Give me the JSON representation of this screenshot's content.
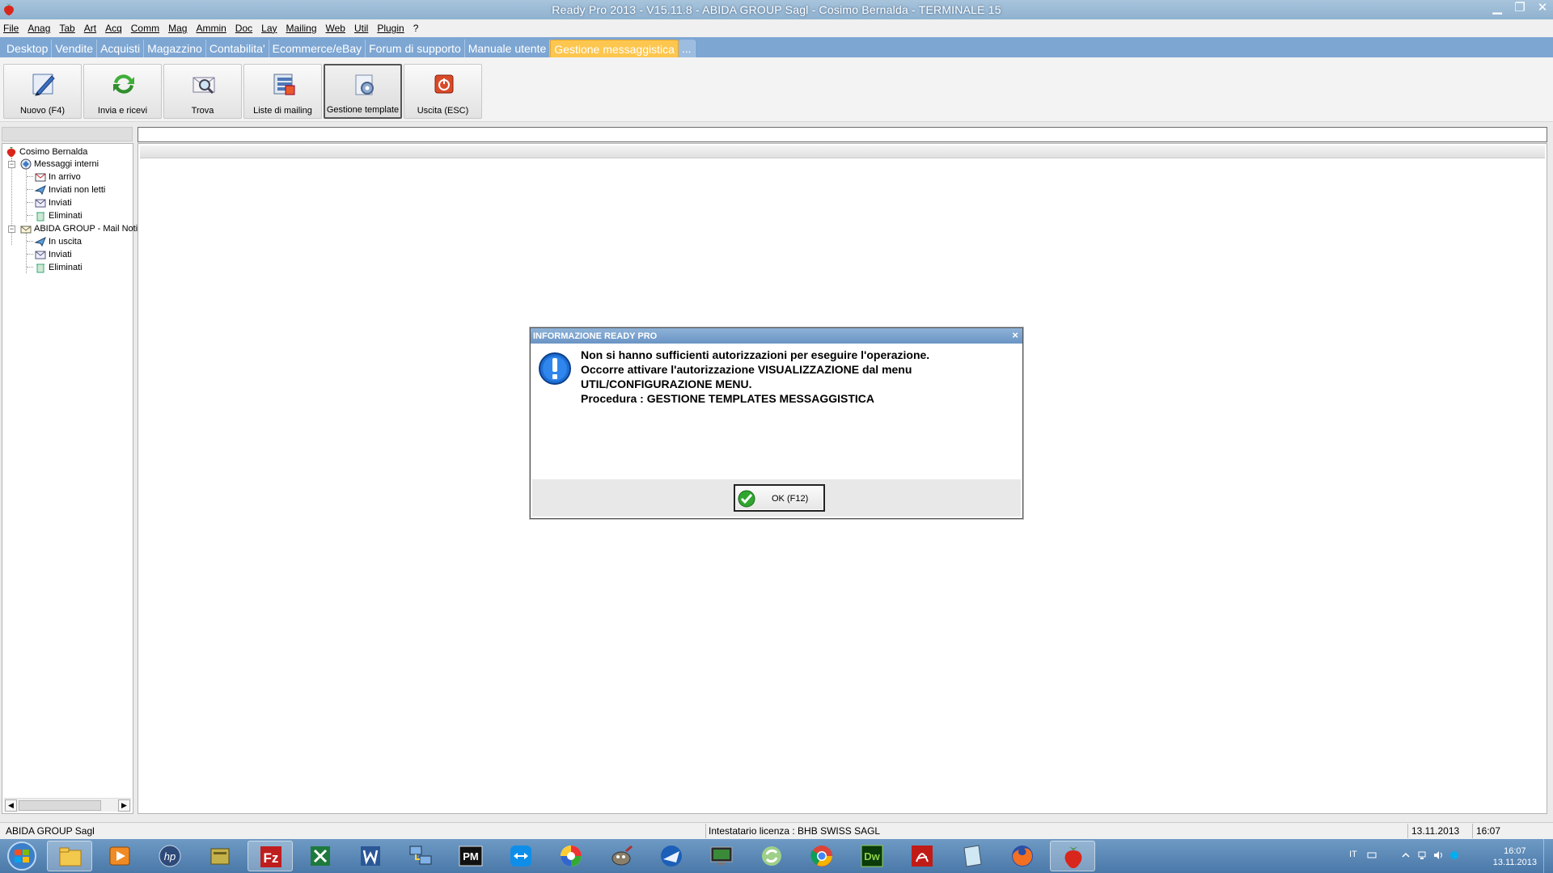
{
  "window": {
    "title": "Ready Pro 2013 - V15.11.8 - ABIDA GROUP Sagl - Cosimo Bernalda - TERMINALE 15",
    "minimize": "▁",
    "restore": "❐",
    "close": "✕"
  },
  "menu": [
    "File",
    "Anag",
    "Tab",
    "Art",
    "Acq",
    "Comm",
    "Mag",
    "Ammin",
    "Doc",
    "Lay",
    "Mailing",
    "Web",
    "Util",
    "Plugin",
    "?"
  ],
  "tabs": [
    {
      "label": "Desktop",
      "active": false
    },
    {
      "label": "Vendite",
      "active": false
    },
    {
      "label": "Acquisti",
      "active": false
    },
    {
      "label": "Magazzino",
      "active": false
    },
    {
      "label": "Contabilita'",
      "active": false
    },
    {
      "label": "Ecommerce/eBay",
      "active": false
    },
    {
      "label": "Forum di supporto",
      "active": false
    },
    {
      "label": "Manuale utente",
      "active": false
    },
    {
      "label": "Gestione messaggistica",
      "active": true
    },
    {
      "label": "...",
      "active": false
    }
  ],
  "toolbar": {
    "new": "Nuovo (F4)",
    "send_receive": "Invia e ricevi",
    "find": "Trova",
    "mailing_lists": "Liste di mailing",
    "templates": "Gestione template",
    "exit": "Uscita (ESC)"
  },
  "tree": {
    "root": "Cosimo Bernalda",
    "internal": {
      "label": "Messaggi interni",
      "items": [
        "In arrivo",
        "Inviati non letti",
        "Inviati",
        "Eliminati"
      ]
    },
    "account": {
      "label": "ABIDA GROUP - Mail Noti",
      "items": [
        "In uscita",
        "Inviati",
        "Eliminati"
      ]
    }
  },
  "dialog": {
    "title": "INFORMAZIONE READY PRO",
    "close": "×",
    "lines": [
      "Non si hanno sufficienti autorizzazioni per eseguire l'operazione.",
      "Occorre attivare l'autorizzazione VISUALIZZAZIONE dal menu",
      "UTIL/CONFIGURAZIONE MENU.",
      "Procedura : GESTIONE TEMPLATES MESSAGGISTICA"
    ],
    "ok_label": "OK (F12)"
  },
  "status": {
    "company": "ABIDA GROUP Sagl",
    "license": "Intestatario licenza : BHB SWISS SAGL",
    "date": "13.11.2013",
    "time": "16:07"
  },
  "taskbar": {
    "apps": [
      "explorer-icon",
      "media-player-icon",
      "hp-icon",
      "archive-icon",
      "filezilla-icon",
      "excel-icon",
      "word-icon",
      "network-icon",
      "pm-icon",
      "teamviewer-icon",
      "picasa-icon",
      "gimp-icon",
      "thunderbird-icon",
      "monitor-icon",
      "recycle-icon",
      "chrome-icon",
      "dreamweaver-icon",
      "acrobat-icon",
      "notepad-icon",
      "firefox-icon",
      "readypro-icon"
    ],
    "pm_label": "PM",
    "dw_label": "Dw",
    "fz_label": "Fz",
    "lang": "IT",
    "clock_time": "16:07",
    "clock_date": "13.11.2013"
  }
}
